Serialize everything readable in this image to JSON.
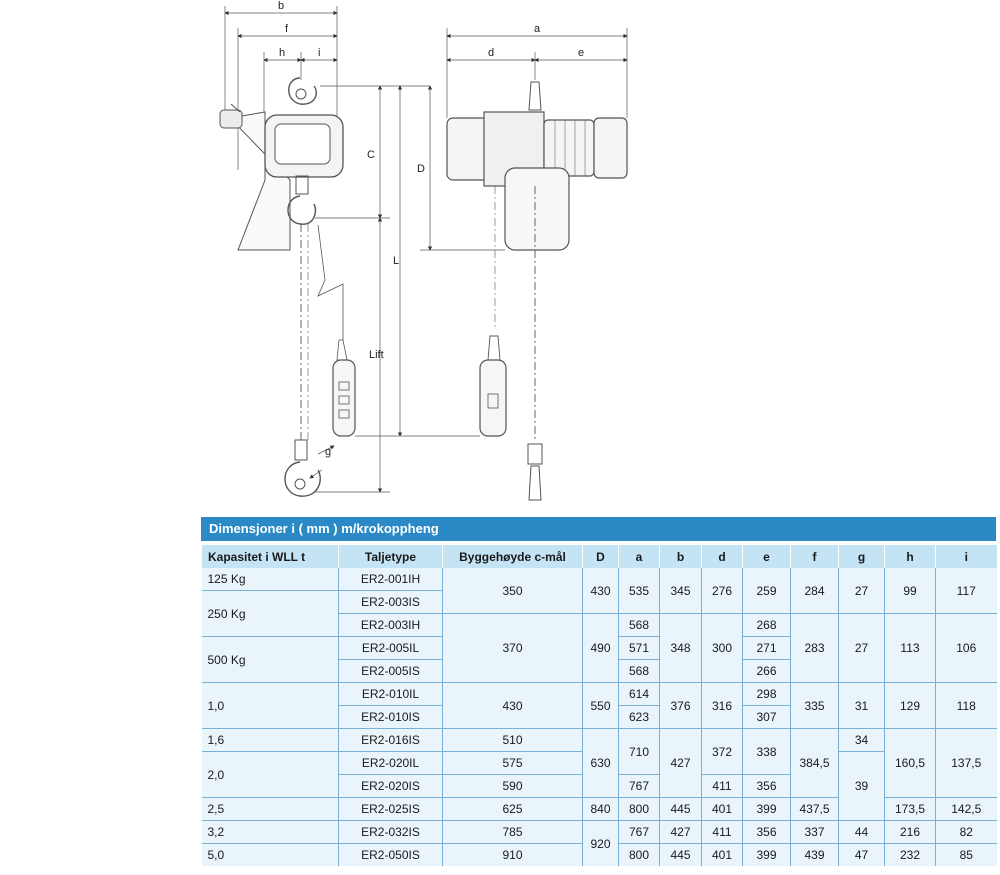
{
  "drawing": {
    "labels": {
      "b": "b",
      "f": "f",
      "h": "h",
      "i": "i",
      "a": "a",
      "d": "d",
      "e": "e",
      "C": "C",
      "D": "D",
      "L": "L",
      "lift": "Lift",
      "g": "g"
    }
  },
  "table": {
    "title": "Dimensjoner i ( mm ) m/krokoppheng",
    "headers": {
      "capacity": "Kapasitet i WLL t",
      "type": "Taljetype",
      "height": "Byggehøyde  c-mål",
      "D": "D",
      "a": "a",
      "b": "b",
      "d": "d",
      "e": "e",
      "f": "f",
      "g": "g",
      "h": "h",
      "i": "i"
    },
    "cells": {
      "cap_125kg": "125 Kg",
      "cap_250kg": "250 Kg",
      "cap_500kg": "500 Kg",
      "cap_1_0": "1,0",
      "cap_1_6": "1,6",
      "cap_2_0": "2,0",
      "cap_2_5": "2,5",
      "cap_3_2": "3,2",
      "cap_5_0": "5,0",
      "t_001IH": "ER2-001IH",
      "t_003IS": "ER2-003IS",
      "t_003IH": "ER2-003IH",
      "t_005IL": "ER2-005IL",
      "t_005IS": "ER2-005IS",
      "t_010IL": "ER2-010IL",
      "t_010IS": "ER2-010IS",
      "t_016IS": "ER2-016IS",
      "t_020IL": "ER2-020IL",
      "t_020IS": "ER2-020IS",
      "t_025IS": "ER2-025IS",
      "t_032IS": "ER2-032IS",
      "t_050IS": "ER2-050IS",
      "h_350": "350",
      "D_430": "430",
      "a_535": "535",
      "b_345": "345",
      "d_276": "276",
      "e_259": "259",
      "f_284": "284",
      "g_27a": "27",
      "h_99": "99",
      "i_117": "117",
      "h_370": "370",
      "D_490": "490",
      "a_568a": "568",
      "a_571": "571",
      "a_568b": "568",
      "b_348": "348",
      "d_300": "300",
      "e_268": "268",
      "e_271": "271",
      "e_266": "266",
      "f_283": "283",
      "g_27b": "27",
      "h_113": "113",
      "i_106": "106",
      "h_430": "430",
      "D_550": "550",
      "a_614": "614",
      "a_623": "623",
      "b_376": "376",
      "d_316": "316",
      "e_298": "298",
      "e_307": "307",
      "f_335": "335",
      "g_31": "31",
      "h_129": "129",
      "i_118": "118",
      "h_510": "510",
      "h_575": "575",
      "h_590": "590",
      "D_630": "630",
      "a_710": "710",
      "a_767a": "767",
      "b_427a": "427",
      "d_372": "372",
      "d_411a": "411",
      "e_338": "338",
      "e_356a": "356",
      "f_384_5": "384,5",
      "g_34": "34",
      "g_39": "39",
      "h_160_5": "160,5",
      "i_137_5": "137,5",
      "h_625": "625",
      "D_840": "840",
      "a_800a": "800",
      "b_445a": "445",
      "d_401a": "401",
      "e_399a": "399",
      "f_437_5": "437,5",
      "h_173_5": "173,5",
      "i_142_5": "142,5",
      "h_785": "785",
      "D_920": "920",
      "a_767b": "767",
      "b_427b": "427",
      "d_411b": "411",
      "e_356b": "356",
      "f_337": "337",
      "g_44": "44",
      "h_216": "216",
      "i_82": "82",
      "h_910": "910",
      "a_800b": "800",
      "b_445b": "445",
      "d_401b": "401",
      "e_399b": "399",
      "f_439": "439",
      "g_47": "47",
      "h_232": "232",
      "i_85": "85"
    }
  }
}
